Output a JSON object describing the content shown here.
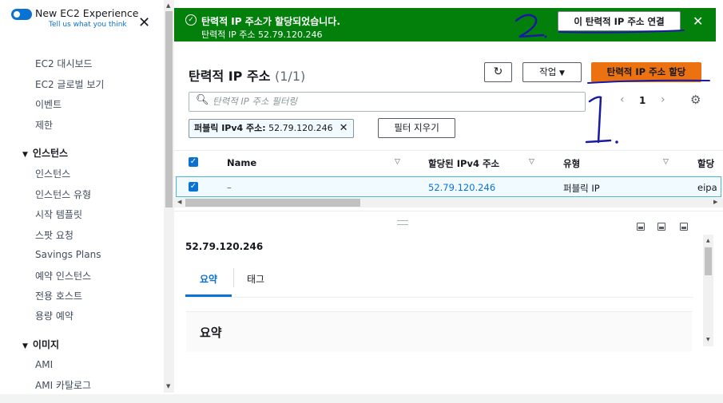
{
  "sidebar": {
    "toggle_title": "New EC2 Experience",
    "toggle_sub": "Tell us what you think",
    "items": [
      {
        "label": "EC2 대시보드"
      },
      {
        "label": "EC2 글로벌 보기"
      },
      {
        "label": "이벤트"
      },
      {
        "label": "제한"
      }
    ],
    "sections": [
      {
        "label": "인스턴스",
        "items": [
          "인스턴스",
          "인스턴스 유형",
          "시작 템플릿",
          "스팟 요청",
          "Savings Plans",
          "예약 인스턴스",
          "전용 호스트",
          "용량 예약"
        ]
      },
      {
        "label": "이미지",
        "items": [
          "AMI",
          "AMI 카탈로그"
        ]
      }
    ]
  },
  "flash": {
    "title": "탄력적 IP 주소가 할당되었습니다.",
    "message": "탄력적 IP 주소 52.79.120.246",
    "action_label": "이 탄력적 IP 주소 연결",
    "color": "#037f0c"
  },
  "panel": {
    "title": "탄력적 IP 주소",
    "count": "(1/1)",
    "actions_label": "작업",
    "allocate_label": "탄력적 IP 주소 할당",
    "search_placeholder": "탄력적 IP 주소 필터링",
    "page": "1",
    "filter_token_key": "퍼블릭 IPv4 주소:",
    "filter_token_value": "52.79.120.246",
    "clear_filters_label": "필터 지우기"
  },
  "table": {
    "columns": [
      "Name",
      "할당된 IPv4 주소",
      "유형",
      "할당"
    ],
    "rows": [
      {
        "name": "–",
        "ipv4": "52.79.120.246",
        "type": "퍼블릭 IP",
        "alloc": "eipa"
      }
    ]
  },
  "detail": {
    "title": "52.79.120.246",
    "tabs": [
      "요약",
      "태그"
    ],
    "section_title": "요약"
  },
  "annotations": {
    "one": "1.",
    "two": "2."
  },
  "colors": {
    "accent": "#0972d3",
    "primary_button": "#ec7211",
    "ink": "#1a1aa0"
  }
}
